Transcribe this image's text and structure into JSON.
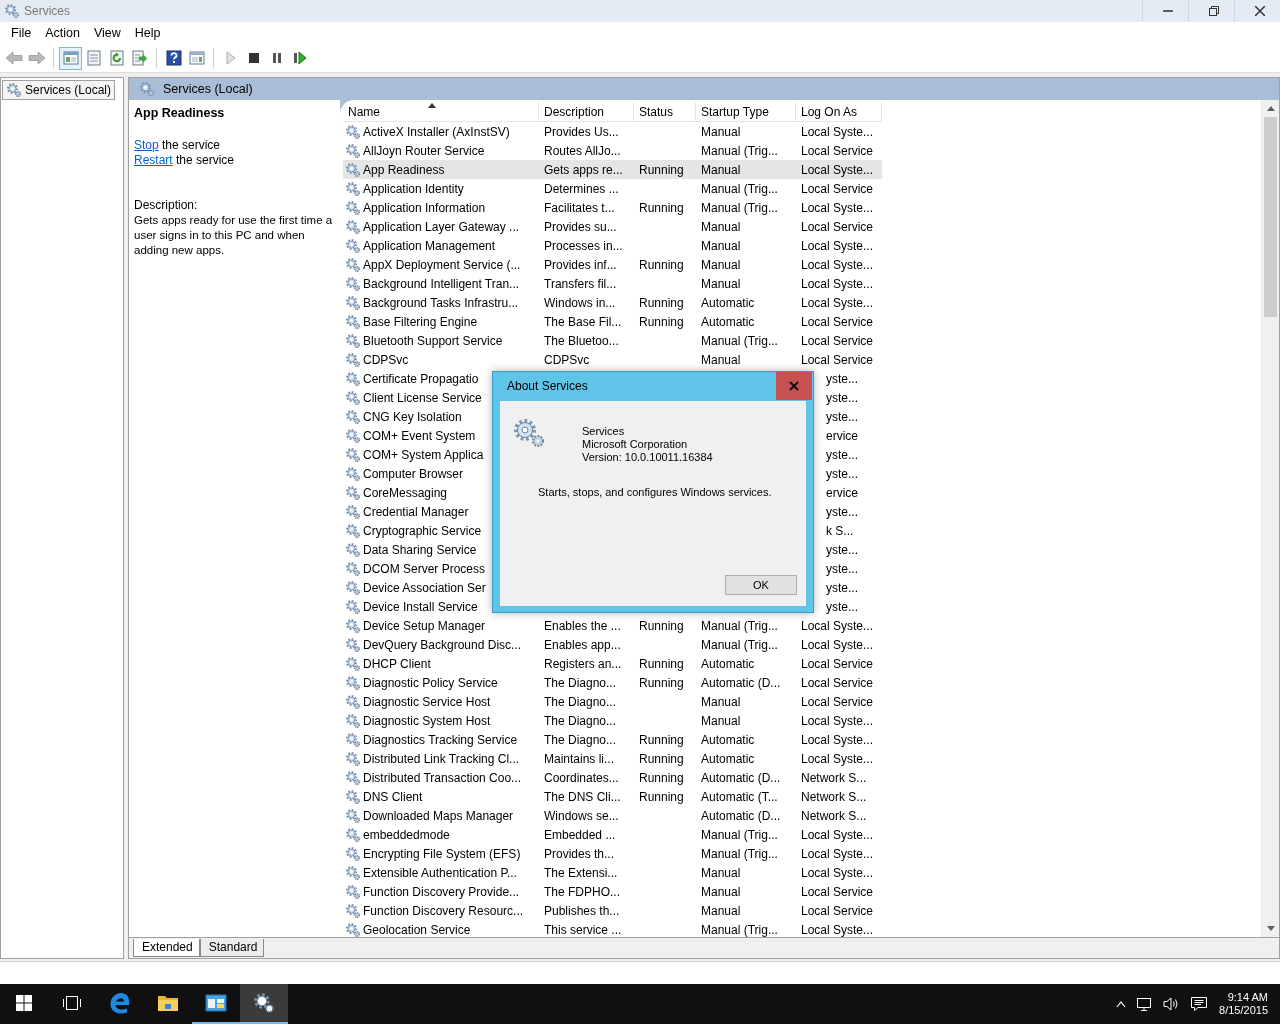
{
  "window": {
    "title": "Services"
  },
  "menu": [
    "File",
    "Action",
    "View",
    "Help"
  ],
  "toolbar": [
    {
      "kind": "back",
      "disabled": true,
      "pressed": false
    },
    {
      "kind": "forward",
      "disabled": true,
      "pressed": false
    },
    {
      "kind": "console-tree",
      "disabled": false,
      "pressed": true
    },
    {
      "kind": "properties",
      "disabled": false,
      "pressed": false
    },
    {
      "kind": "refresh",
      "disabled": false,
      "pressed": false
    },
    {
      "kind": "export",
      "disabled": false,
      "pressed": false
    },
    {
      "kind": "help",
      "disabled": false,
      "pressed": false
    },
    {
      "kind": "action-pane",
      "disabled": false,
      "pressed": false
    },
    {
      "kind": "start",
      "disabled": true,
      "pressed": false
    },
    {
      "kind": "stop",
      "disabled": false,
      "pressed": false
    },
    {
      "kind": "pause",
      "disabled": false,
      "pressed": false
    },
    {
      "kind": "resume",
      "disabled": false,
      "pressed": false
    }
  ],
  "tree": {
    "items": [
      {
        "label": "Services (Local)",
        "selected": true
      }
    ]
  },
  "pane_header": "Services (Local)",
  "details": {
    "title": "App Readiness",
    "actions": [
      {
        "link": "Stop",
        "text": "the service"
      },
      {
        "link": "Restart",
        "text": "the service"
      }
    ],
    "description_label": "Description:",
    "description": "Gets apps ready for use the first time a user signs in to this PC and when adding new apps."
  },
  "table": {
    "columns": [
      {
        "label": "Name",
        "sorted": true
      },
      {
        "label": "Description",
        "sorted": false
      },
      {
        "label": "Status",
        "sorted": false
      },
      {
        "label": "Startup Type",
        "sorted": false
      },
      {
        "label": "Log On As",
        "sorted": false
      }
    ],
    "rows": [
      {
        "kind": "full",
        "selected": false,
        "name": "ActiveX Installer (AxInstSV)",
        "description": "Provides Us...",
        "startup": "Manual",
        "log_on": "Local Syste..."
      },
      {
        "kind": "full",
        "selected": false,
        "name": "AllJoyn Router Service",
        "description": "Routes AllJo...",
        "startup": "Manual (Trig...",
        "log_on": "Local Service"
      },
      {
        "kind": "full",
        "selected": true,
        "name": "App Readiness",
        "description": "Gets apps re...",
        "status": "Running",
        "startup": "Manual",
        "log_on": "Local Syste..."
      },
      {
        "kind": "full",
        "selected": false,
        "name": "Application Identity",
        "description": "Determines ...",
        "startup": "Manual (Trig...",
        "log_on": "Local Service"
      },
      {
        "kind": "full",
        "selected": false,
        "name": "Application Information",
        "description": "Facilitates t...",
        "status": "Running",
        "startup": "Manual (Trig...",
        "log_on": "Local Syste..."
      },
      {
        "kind": "full",
        "selected": false,
        "name": "Application Layer Gateway ...",
        "description": "Provides su...",
        "startup": "Manual",
        "log_on": "Local Service"
      },
      {
        "kind": "full",
        "selected": false,
        "name": "Application Management",
        "description": "Processes in...",
        "startup": "Manual",
        "log_on": "Local Syste..."
      },
      {
        "kind": "full",
        "selected": false,
        "name": "AppX Deployment Service (...",
        "description": "Provides inf...",
        "status": "Running",
        "startup": "Manual",
        "log_on": "Local Syste..."
      },
      {
        "kind": "full",
        "selected": false,
        "name": "Background Intelligent Tran...",
        "description": "Transfers fil...",
        "startup": "Manual",
        "log_on": "Local Syste..."
      },
      {
        "kind": "full",
        "selected": false,
        "name": "Background Tasks Infrastru...",
        "description": "Windows in...",
        "status": "Running",
        "startup": "Automatic",
        "log_on": "Local Syste..."
      },
      {
        "kind": "full",
        "selected": false,
        "name": "Base Filtering Engine",
        "description": "The Base Fil...",
        "status": "Running",
        "startup": "Automatic",
        "log_on": "Local Service"
      },
      {
        "kind": "full",
        "selected": false,
        "name": "Bluetooth Support Service",
        "description": "The Bluetoo...",
        "startup": "Manual (Trig...",
        "log_on": "Local Service"
      },
      {
        "kind": "full",
        "selected": false,
        "name": "CDPSvc",
        "description": "CDPSvc",
        "startup": "Manual",
        "log_on": "Local Service"
      },
      {
        "kind": "covered",
        "selected": false,
        "name": "Certificate Propagatio",
        "log_on": "yste..."
      },
      {
        "kind": "covered",
        "selected": false,
        "name": "Client License Service",
        "log_on": "yste..."
      },
      {
        "kind": "covered",
        "selected": false,
        "name": "CNG Key Isolation",
        "log_on": "yste..."
      },
      {
        "kind": "covered",
        "selected": false,
        "name": "COM+ Event System",
        "log_on": "ervice"
      },
      {
        "kind": "covered",
        "selected": false,
        "name": "COM+ System Applica",
        "log_on": "yste..."
      },
      {
        "kind": "covered",
        "selected": false,
        "name": "Computer Browser",
        "log_on": "yste..."
      },
      {
        "kind": "covered",
        "selected": false,
        "name": "CoreMessaging",
        "log_on": "ervice"
      },
      {
        "kind": "covered",
        "selected": false,
        "name": "Credential Manager",
        "log_on": "yste..."
      },
      {
        "kind": "covered",
        "selected": false,
        "name": "Cryptographic Service",
        "log_on": "k S..."
      },
      {
        "kind": "covered",
        "selected": false,
        "name": "Data Sharing Service",
        "log_on": "yste..."
      },
      {
        "kind": "covered",
        "selected": false,
        "name": "DCOM Server Process",
        "log_on": "yste..."
      },
      {
        "kind": "covered",
        "selected": false,
        "name": "Device Association Ser",
        "log_on": "yste..."
      },
      {
        "kind": "covered",
        "selected": false,
        "name": "Device Install Service",
        "log_on": "yste..."
      },
      {
        "kind": "full",
        "selected": false,
        "name": "Device Setup Manager",
        "description": "Enables the ...",
        "status": "Running",
        "startup": "Manual (Trig...",
        "log_on": "Local Syste..."
      },
      {
        "kind": "full",
        "selected": false,
        "name": "DevQuery Background Disc...",
        "description": "Enables app...",
        "startup": "Manual (Trig...",
        "log_on": "Local Syste..."
      },
      {
        "kind": "full",
        "selected": false,
        "name": "DHCP Client",
        "description": "Registers an...",
        "status": "Running",
        "startup": "Automatic",
        "log_on": "Local Service"
      },
      {
        "kind": "full",
        "selected": false,
        "name": "Diagnostic Policy Service",
        "description": "The Diagno...",
        "status": "Running",
        "startup": "Automatic (D...",
        "log_on": "Local Service"
      },
      {
        "kind": "full",
        "selected": false,
        "name": "Diagnostic Service Host",
        "description": "The Diagno...",
        "startup": "Manual",
        "log_on": "Local Service"
      },
      {
        "kind": "full",
        "selected": false,
        "name": "Diagnostic System Host",
        "description": "The Diagno...",
        "startup": "Manual",
        "log_on": "Local Syste..."
      },
      {
        "kind": "full",
        "selected": false,
        "name": "Diagnostics Tracking Service",
        "description": "The Diagno...",
        "status": "Running",
        "startup": "Automatic",
        "log_on": "Local Syste..."
      },
      {
        "kind": "full",
        "selected": false,
        "name": "Distributed Link Tracking Cl...",
        "description": "Maintains li...",
        "status": "Running",
        "startup": "Automatic",
        "log_on": "Local Syste..."
      },
      {
        "kind": "full",
        "selected": false,
        "name": "Distributed Transaction Coo...",
        "description": "Coordinates...",
        "status": "Running",
        "startup": "Automatic (D...",
        "log_on": "Network S..."
      },
      {
        "kind": "full",
        "selected": false,
        "name": "DNS Client",
        "description": "The DNS Cli...",
        "status": "Running",
        "startup": "Automatic (T...",
        "log_on": "Network S..."
      },
      {
        "kind": "full",
        "selected": false,
        "name": "Downloaded Maps Manager",
        "description": "Windows se...",
        "startup": "Automatic (D...",
        "log_on": "Network S..."
      },
      {
        "kind": "full",
        "selected": false,
        "name": "embeddedmode",
        "description": "Embedded ...",
        "startup": "Manual (Trig...",
        "log_on": "Local Syste..."
      },
      {
        "kind": "full",
        "selected": false,
        "name": "Encrypting File System (EFS)",
        "description": "Provides th...",
        "startup": "Manual (Trig...",
        "log_on": "Local Syste..."
      },
      {
        "kind": "full",
        "selected": false,
        "name": "Extensible Authentication P...",
        "description": "The Extensi...",
        "startup": "Manual",
        "log_on": "Local Syste..."
      },
      {
        "kind": "full",
        "selected": false,
        "name": "Function Discovery Provide...",
        "description": "The FDPHO...",
        "startup": "Manual",
        "log_on": "Local Service"
      },
      {
        "kind": "full",
        "selected": false,
        "name": "Function Discovery Resourc...",
        "description": "Publishes th...",
        "startup": "Manual",
        "log_on": "Local Service"
      },
      {
        "kind": "full",
        "selected": false,
        "name": "Geolocation Service",
        "description": "This service ...",
        "startup": "Manual (Trig...",
        "log_on": "Local Syste..."
      }
    ]
  },
  "view_tabs": [
    {
      "label": "Extended",
      "selected": true
    },
    {
      "label": "Standard",
      "selected": false
    }
  ],
  "dialog": {
    "title": "About Services",
    "product": "Services",
    "company": "Microsoft Corporation",
    "version": "Version: 10.0.10011.16384",
    "description": "Starts, stops, and configures Windows services.",
    "button": "OK"
  },
  "taskbar": {
    "apps": [
      {
        "kind": "start"
      },
      {
        "kind": "task-view"
      },
      {
        "kind": "edge",
        "running": false,
        "active": false
      },
      {
        "kind": "explorer",
        "running": false,
        "active": false
      },
      {
        "kind": "console",
        "running": true,
        "active": false
      },
      {
        "kind": "services",
        "running": true,
        "active": true
      }
    ],
    "tray": [
      {
        "kind": "chevron"
      },
      {
        "kind": "network"
      },
      {
        "kind": "volume"
      },
      {
        "kind": "notifications"
      }
    ],
    "clock": {
      "time": "9:14 AM",
      "date": "8/15/2015"
    }
  }
}
